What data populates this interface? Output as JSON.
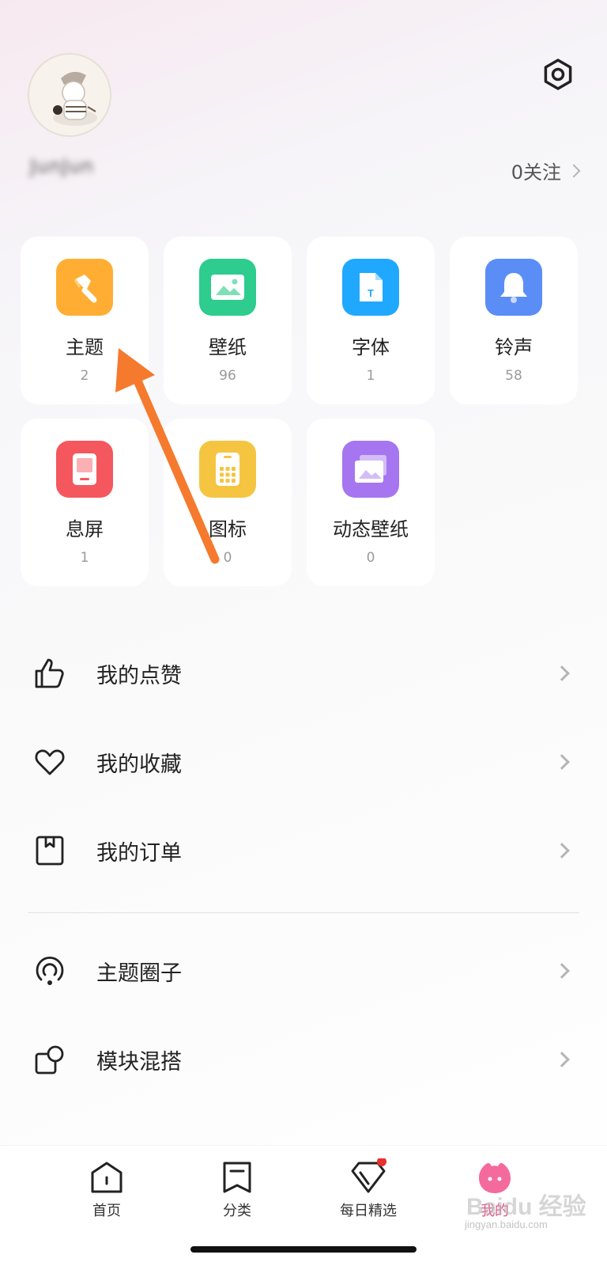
{
  "profile": {
    "username": "JunJun",
    "follow_label": "0关注"
  },
  "grid": [
    {
      "label": "主题",
      "count": "2",
      "icon": "theme-brush-icon",
      "color": "#FFAE33"
    },
    {
      "label": "壁纸",
      "count": "96",
      "icon": "wallpaper-icon",
      "color": "#2ECC8E"
    },
    {
      "label": "字体",
      "count": "1",
      "icon": "font-icon",
      "color": "#20A8FF"
    },
    {
      "label": "铃声",
      "count": "58",
      "icon": "bell-icon",
      "color": "#5B8DF7"
    },
    {
      "label": "息屏",
      "count": "1",
      "icon": "lockscreen-icon",
      "color": "#F4585E"
    },
    {
      "label": "图标",
      "count": "0",
      "icon": "app-icon-icon",
      "color": "#F5C542"
    },
    {
      "label": "动态壁纸",
      "count": "0",
      "icon": "live-wallpaper-icon",
      "color": "#A675F0"
    }
  ],
  "menu": [
    {
      "label": "我的点赞",
      "icon": "thumbs-up-icon"
    },
    {
      "label": "我的收藏",
      "icon": "heart-icon"
    },
    {
      "label": "我的订单",
      "icon": "order-icon"
    },
    {
      "label": "主题圈子",
      "icon": "circle-icon"
    },
    {
      "label": "模块混搭",
      "icon": "module-icon"
    }
  ],
  "tabs": [
    {
      "label": "首页",
      "icon": "home-icon"
    },
    {
      "label": "分类",
      "icon": "category-icon"
    },
    {
      "label": "每日精选",
      "icon": "daily-pick-icon",
      "badge": true
    },
    {
      "label": "我的",
      "icon": "profile-icon",
      "active": true
    }
  ],
  "watermark": {
    "text": "Baidu 经验",
    "sub": "jingyan.baidu.com"
  },
  "colors": {
    "accent": "#EC4F86",
    "arrow": "#F57A2E",
    "badge": "#E8302F"
  }
}
